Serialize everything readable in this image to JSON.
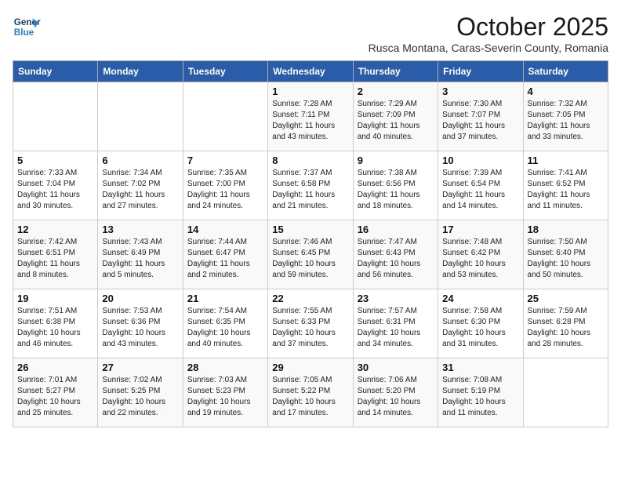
{
  "logo": {
    "line1": "General",
    "line2": "Blue"
  },
  "title": "October 2025",
  "subtitle": "Rusca Montana, Caras-Severin County, Romania",
  "weekdays": [
    "Sunday",
    "Monday",
    "Tuesday",
    "Wednesday",
    "Thursday",
    "Friday",
    "Saturday"
  ],
  "weeks": [
    [
      {
        "day": "",
        "info": ""
      },
      {
        "day": "",
        "info": ""
      },
      {
        "day": "",
        "info": ""
      },
      {
        "day": "1",
        "info": "Sunrise: 7:28 AM\nSunset: 7:11 PM\nDaylight: 11 hours\nand 43 minutes."
      },
      {
        "day": "2",
        "info": "Sunrise: 7:29 AM\nSunset: 7:09 PM\nDaylight: 11 hours\nand 40 minutes."
      },
      {
        "day": "3",
        "info": "Sunrise: 7:30 AM\nSunset: 7:07 PM\nDaylight: 11 hours\nand 37 minutes."
      },
      {
        "day": "4",
        "info": "Sunrise: 7:32 AM\nSunset: 7:05 PM\nDaylight: 11 hours\nand 33 minutes."
      }
    ],
    [
      {
        "day": "5",
        "info": "Sunrise: 7:33 AM\nSunset: 7:04 PM\nDaylight: 11 hours\nand 30 minutes."
      },
      {
        "day": "6",
        "info": "Sunrise: 7:34 AM\nSunset: 7:02 PM\nDaylight: 11 hours\nand 27 minutes."
      },
      {
        "day": "7",
        "info": "Sunrise: 7:35 AM\nSunset: 7:00 PM\nDaylight: 11 hours\nand 24 minutes."
      },
      {
        "day": "8",
        "info": "Sunrise: 7:37 AM\nSunset: 6:58 PM\nDaylight: 11 hours\nand 21 minutes."
      },
      {
        "day": "9",
        "info": "Sunrise: 7:38 AM\nSunset: 6:56 PM\nDaylight: 11 hours\nand 18 minutes."
      },
      {
        "day": "10",
        "info": "Sunrise: 7:39 AM\nSunset: 6:54 PM\nDaylight: 11 hours\nand 14 minutes."
      },
      {
        "day": "11",
        "info": "Sunrise: 7:41 AM\nSunset: 6:52 PM\nDaylight: 11 hours\nand 11 minutes."
      }
    ],
    [
      {
        "day": "12",
        "info": "Sunrise: 7:42 AM\nSunset: 6:51 PM\nDaylight: 11 hours\nand 8 minutes."
      },
      {
        "day": "13",
        "info": "Sunrise: 7:43 AM\nSunset: 6:49 PM\nDaylight: 11 hours\nand 5 minutes."
      },
      {
        "day": "14",
        "info": "Sunrise: 7:44 AM\nSunset: 6:47 PM\nDaylight: 11 hours\nand 2 minutes."
      },
      {
        "day": "15",
        "info": "Sunrise: 7:46 AM\nSunset: 6:45 PM\nDaylight: 10 hours\nand 59 minutes."
      },
      {
        "day": "16",
        "info": "Sunrise: 7:47 AM\nSunset: 6:43 PM\nDaylight: 10 hours\nand 56 minutes."
      },
      {
        "day": "17",
        "info": "Sunrise: 7:48 AM\nSunset: 6:42 PM\nDaylight: 10 hours\nand 53 minutes."
      },
      {
        "day": "18",
        "info": "Sunrise: 7:50 AM\nSunset: 6:40 PM\nDaylight: 10 hours\nand 50 minutes."
      }
    ],
    [
      {
        "day": "19",
        "info": "Sunrise: 7:51 AM\nSunset: 6:38 PM\nDaylight: 10 hours\nand 46 minutes."
      },
      {
        "day": "20",
        "info": "Sunrise: 7:53 AM\nSunset: 6:36 PM\nDaylight: 10 hours\nand 43 minutes."
      },
      {
        "day": "21",
        "info": "Sunrise: 7:54 AM\nSunset: 6:35 PM\nDaylight: 10 hours\nand 40 minutes."
      },
      {
        "day": "22",
        "info": "Sunrise: 7:55 AM\nSunset: 6:33 PM\nDaylight: 10 hours\nand 37 minutes."
      },
      {
        "day": "23",
        "info": "Sunrise: 7:57 AM\nSunset: 6:31 PM\nDaylight: 10 hours\nand 34 minutes."
      },
      {
        "day": "24",
        "info": "Sunrise: 7:58 AM\nSunset: 6:30 PM\nDaylight: 10 hours\nand 31 minutes."
      },
      {
        "day": "25",
        "info": "Sunrise: 7:59 AM\nSunset: 6:28 PM\nDaylight: 10 hours\nand 28 minutes."
      }
    ],
    [
      {
        "day": "26",
        "info": "Sunrise: 7:01 AM\nSunset: 5:27 PM\nDaylight: 10 hours\nand 25 minutes."
      },
      {
        "day": "27",
        "info": "Sunrise: 7:02 AM\nSunset: 5:25 PM\nDaylight: 10 hours\nand 22 minutes."
      },
      {
        "day": "28",
        "info": "Sunrise: 7:03 AM\nSunset: 5:23 PM\nDaylight: 10 hours\nand 19 minutes."
      },
      {
        "day": "29",
        "info": "Sunrise: 7:05 AM\nSunset: 5:22 PM\nDaylight: 10 hours\nand 17 minutes."
      },
      {
        "day": "30",
        "info": "Sunrise: 7:06 AM\nSunset: 5:20 PM\nDaylight: 10 hours\nand 14 minutes."
      },
      {
        "day": "31",
        "info": "Sunrise: 7:08 AM\nSunset: 5:19 PM\nDaylight: 10 hours\nand 11 minutes."
      },
      {
        "day": "",
        "info": ""
      }
    ]
  ]
}
